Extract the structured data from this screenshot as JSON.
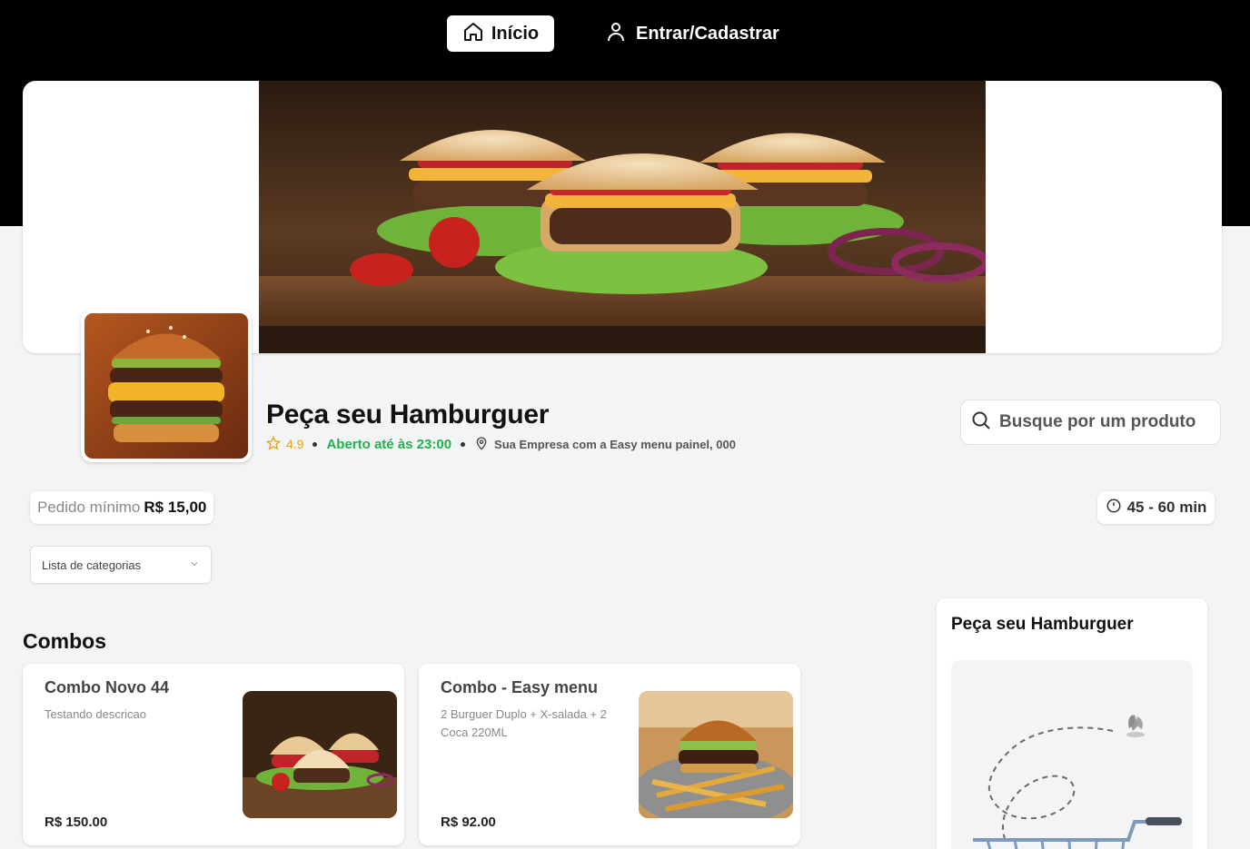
{
  "nav": {
    "home_label": "Início",
    "login_label": "Entrar/Cadastrar"
  },
  "store": {
    "name": "Peça seu Hamburguer",
    "rating": "4.9",
    "open_status": "Aberto até às 23:00",
    "address": "Sua Empresa com a Easy menu painel, 000"
  },
  "search": {
    "placeholder": "Busque por um produto"
  },
  "min_order": {
    "label": "Pedido mínimo",
    "value": "R$ 15,00"
  },
  "delivery_time": "45 - 60 min",
  "category_select": {
    "selected": "Lista de categorias"
  },
  "section": {
    "title": "Combos"
  },
  "products": [
    {
      "name": "Combo Novo 44",
      "description": "Testando descricao",
      "price": "R$ 150.00"
    },
    {
      "name": "Combo - Easy menu",
      "description": "2 Burguer Duplo + X-salada + 2 Coca 220ML",
      "price": "R$ 92.00"
    }
  ],
  "cart": {
    "title": "Peça seu Hamburguer"
  },
  "colors": {
    "header_bg": "#000000",
    "page_bg": "#f3f4f6",
    "open_green": "#22b14c",
    "rating_gold": "#e8a317"
  }
}
